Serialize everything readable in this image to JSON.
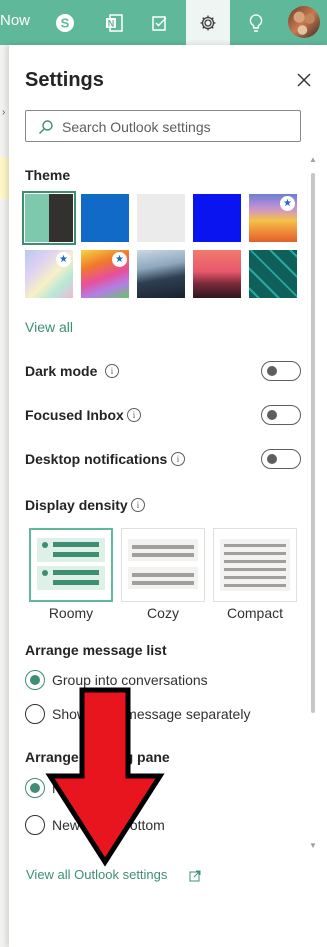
{
  "topbar": {
    "partial_text": "Now",
    "icons": [
      "skype-icon",
      "office-icon",
      "todo-icon",
      "gear-icon",
      "lightbulb-icon",
      "avatar"
    ],
    "color": "#5fb89a"
  },
  "settings": {
    "title": "Settings",
    "search_placeholder": "Search Outlook settings",
    "theme": {
      "heading": "Theme",
      "view_all": "View all",
      "items": [
        {
          "name": "theme-default-green",
          "selected": true
        },
        {
          "name": "theme-blue"
        },
        {
          "name": "theme-light-gray"
        },
        {
          "name": "theme-bright-blue"
        },
        {
          "name": "theme-rainbow",
          "starred": true
        },
        {
          "name": "theme-abstract-pastel",
          "starred": true
        },
        {
          "name": "theme-unicorn",
          "starred": true
        },
        {
          "name": "theme-mountains"
        },
        {
          "name": "theme-palm-sunset"
        },
        {
          "name": "theme-circuit"
        }
      ]
    },
    "dark_mode": "Dark mode",
    "focused_inbox": "Focused Inbox",
    "desktop_notifications": "Desktop notifications",
    "display_density": {
      "heading": "Display density",
      "options": [
        "Roomy",
        "Cozy",
        "Compact"
      ],
      "selected": "Roomy"
    },
    "arrange_message_list": {
      "heading": "Arrange message list",
      "options": [
        "Group into conversations",
        "Show each message separately"
      ],
      "selected": "Group into conversations"
    },
    "arrange_reading_pane": {
      "heading": "Arrange reading pane",
      "options": [
        "Newest on top",
        "Newest on bottom"
      ],
      "selected": "Newest on top"
    },
    "view_all_link": "View all Outlook settings"
  },
  "overlay": {
    "red_arrow_color": "#e8141e"
  }
}
